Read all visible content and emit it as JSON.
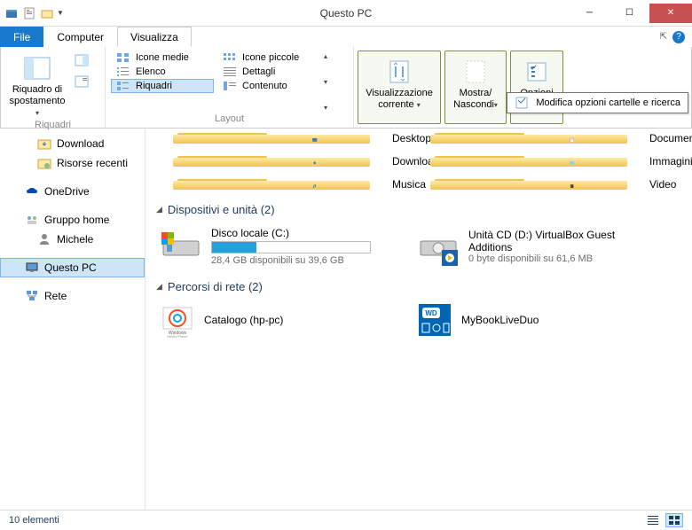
{
  "window": {
    "title": "Questo PC"
  },
  "tabs": {
    "file": "File",
    "computer": "Computer",
    "view": "Visualizza"
  },
  "ribbon": {
    "panes_group": "Riquadri",
    "nav_pane": "Riquadro di spostamento",
    "layout_group": "Layout",
    "layouts": {
      "medium": "Icone medie",
      "small": "Icone piccole",
      "list": "Elenco",
      "details": "Dettagli",
      "tiles": "Riquadri",
      "content": "Contenuto"
    },
    "current_view": "Visualizzazione corrente",
    "show_hide": "Mostra/\nNascondi",
    "options": "Opzioni",
    "tooltip": "Modifica opzioni cartelle e ricerca"
  },
  "sidebar": {
    "download": "Download",
    "recent": "Risorse recenti",
    "onedrive": "OneDrive",
    "homegroup": "Gruppo home",
    "user": "Michele",
    "this_pc": "Questo PC",
    "network": "Rete"
  },
  "folders": {
    "desktop": "Desktop",
    "documents": "Documenti",
    "download": "Download",
    "pictures": "Immagini",
    "music": "Musica",
    "video": "Video"
  },
  "devices": {
    "header": "Dispositivi e unità (2)",
    "local": {
      "name": "Disco locale (C:)",
      "sub": "28,4 GB disponibili su 39,6 GB",
      "pct": 28
    },
    "cd": {
      "name": "Unità CD (D:) VirtualBox Guest Additions",
      "sub": "0 byte disponibili su 61,6 MB"
    }
  },
  "network": {
    "header": "Percorsi di rete (2)",
    "item1": "Catalogo (hp-pc)",
    "item2": "MyBookLiveDuo"
  },
  "status": {
    "count": "10 elementi"
  }
}
